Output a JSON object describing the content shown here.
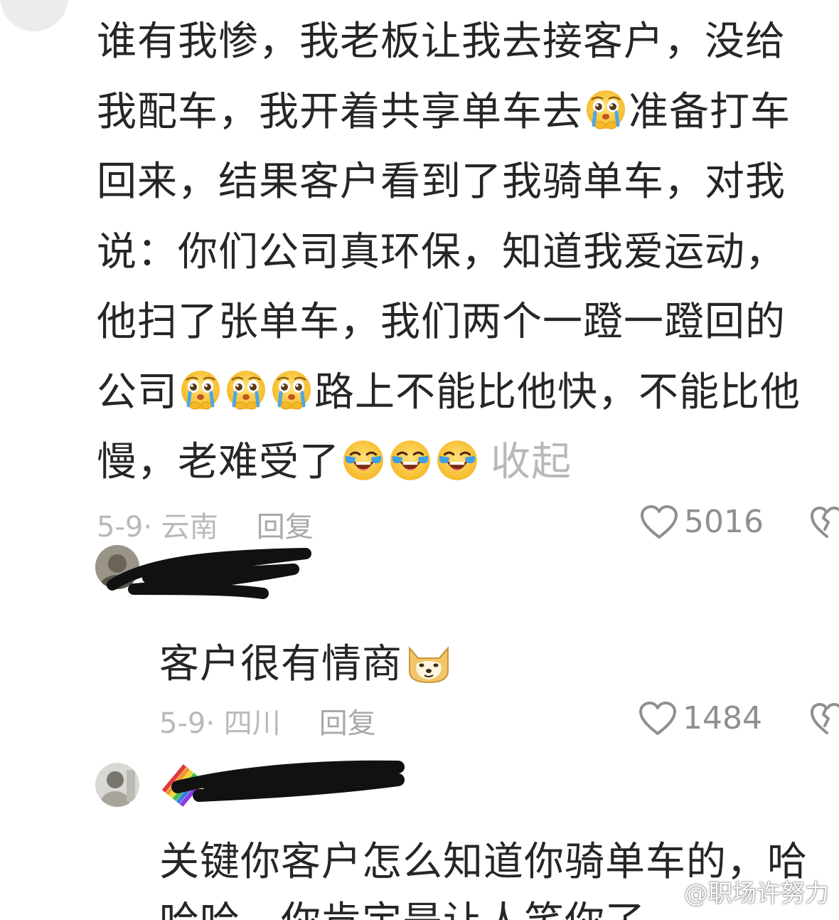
{
  "main_comment": {
    "lines": [
      "谁有我惨，我老板让我去接客户，没给",
      "我配车，我开着共享单车去",
      "准备打车",
      "回来，结果客户看到了我骑单车，对我",
      "说：你们公司真环保，知道我爱运动，",
      "他扫了张单车，我们两个一蹬一蹬回的",
      "公司",
      "路上不能比他快，不能比他",
      "慢，老难受了"
    ],
    "collapse_label": "收起",
    "meta": {
      "date_location": "5-9· 云南",
      "reply_label": "回复",
      "likes": "5016"
    },
    "emojis": {
      "pleading": "pleading-cry-emoji",
      "crying": "loudly-crying-emoji"
    }
  },
  "reply_1": {
    "text": "客户很有情商",
    "emoji": "doge-emoji",
    "meta": {
      "date_location": "5-9· 四川",
      "reply_label": "回复",
      "likes": "1484"
    }
  },
  "reply_2": {
    "line1": "关键你客户怎么知道你骑单车的，哈",
    "line2": "哈哈，你肯定是让人笑你了"
  },
  "watermark": {
    "text": "@职场许努力",
    "icon": "weibo-icon"
  },
  "colors": {
    "text": "#262626",
    "meta": "#b9b9b9",
    "like": "#8f8f8f"
  }
}
